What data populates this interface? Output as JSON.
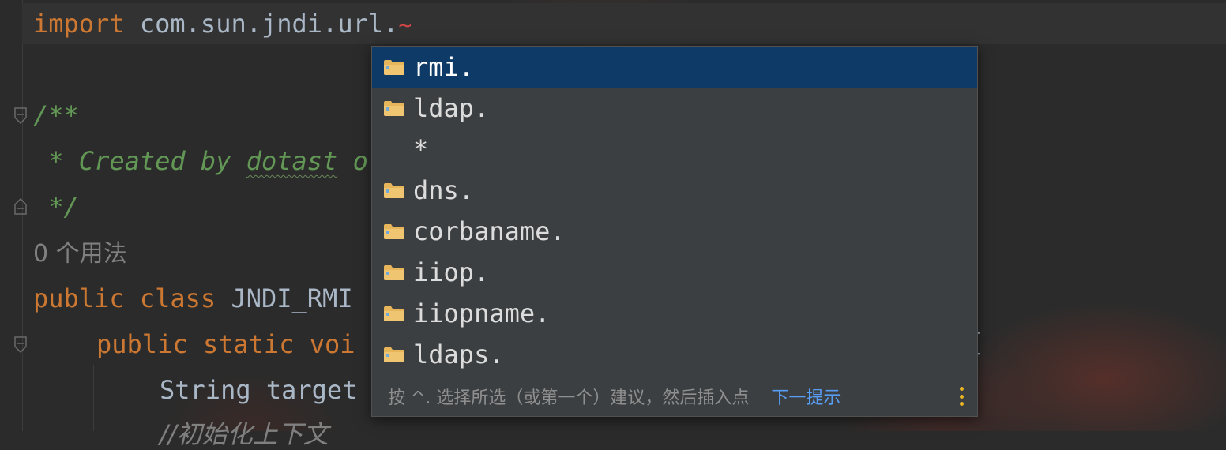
{
  "editor": {
    "lines": {
      "import_kw": "import",
      "import_pkg": "com.sun.jndi.url.",
      "import_err": "~",
      "doc_open": "/**",
      "doc_body_prefix": " * Created by ",
      "doc_author": "dotast",
      "doc_cut": " o",
      "doc_close": " */",
      "usages": "0 个用法",
      "public_kw": "public",
      "class_kw": "class",
      "class_name": "JNDI_RMI",
      "method_public": "public",
      "method_static": "static",
      "method_void": "voi",
      "string_line": "String target",
      "comment_partial": "//初始化上下文",
      "right_edge_glyph": "["
    }
  },
  "completion": {
    "items": [
      {
        "label": "rmi.",
        "icon": "package-folder-icon",
        "selected": true
      },
      {
        "label": "ldap.",
        "icon": "package-folder-icon",
        "selected": false
      },
      {
        "label": "*",
        "icon": "",
        "selected": false
      },
      {
        "label": "dns.",
        "icon": "package-folder-icon",
        "selected": false
      },
      {
        "label": "corbaname.",
        "icon": "package-folder-icon",
        "selected": false
      },
      {
        "label": "iiop.",
        "icon": "package-folder-icon",
        "selected": false
      },
      {
        "label": "iiopname.",
        "icon": "package-folder-icon",
        "selected": false
      },
      {
        "label": "ldaps.",
        "icon": "package-folder-icon",
        "selected": false
      }
    ],
    "footer": {
      "hint": "按 ^. 选择所选（或第一个）建议，然后插入点",
      "next_tip": "下一提示"
    }
  },
  "colors": {
    "keyword": "#cc7832",
    "comment": "#629755",
    "selection": "#0d3a66",
    "link": "#589df6",
    "menu_dots": "#e6b422"
  }
}
